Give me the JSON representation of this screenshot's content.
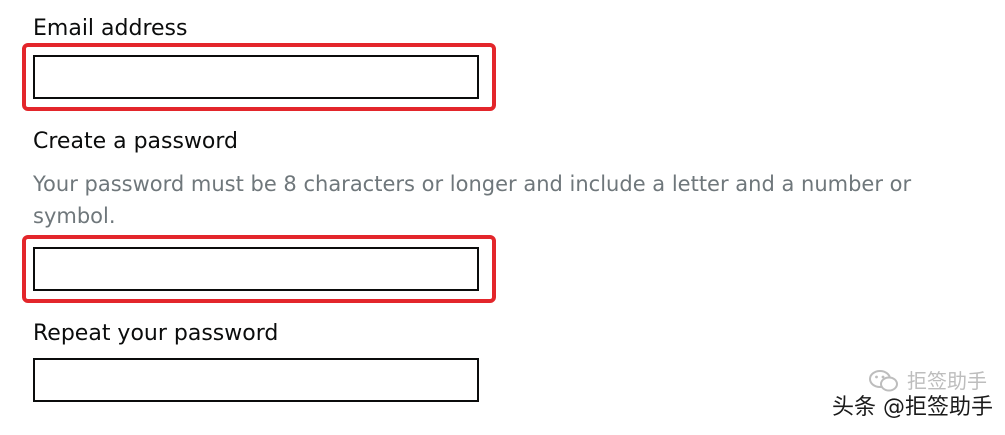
{
  "form": {
    "email": {
      "label": "Email address",
      "value": ""
    },
    "password": {
      "label": "Create a password",
      "hint": "Your password must be 8 characters or longer and include a letter and a number or symbol.",
      "value": ""
    },
    "repeat_password": {
      "label": "Repeat your password",
      "value": ""
    }
  },
  "colors": {
    "highlight": "#e3262b",
    "text": "#0b0c0c",
    "hint": "#6f777b"
  },
  "watermark": {
    "ghost_text": "拒签助手",
    "text": "头条 @拒签助手"
  }
}
